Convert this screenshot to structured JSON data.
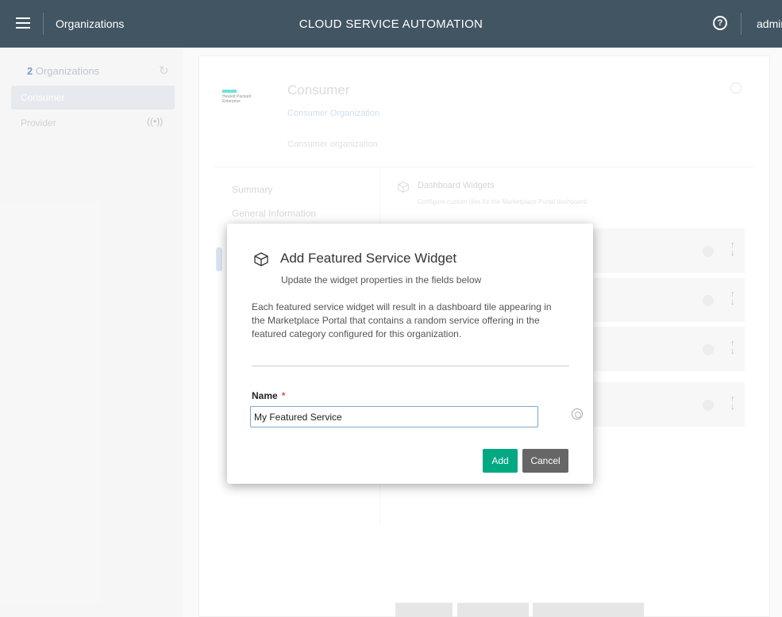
{
  "topbar": {
    "breadcrumb": "Organizations",
    "app_title": "CLOUD SERVICE AUTOMATION",
    "help_icon": "question-circle-icon",
    "user": "admin"
  },
  "sidebar": {
    "count": "2",
    "count_label": "Organizations",
    "items": [
      {
        "label": "Consumer"
      },
      {
        "label": "Provider"
      }
    ]
  },
  "org": {
    "logo_line1": "Hewlett Packard",
    "logo_line2": "Enterprise",
    "title": "Consumer",
    "link": "Consumer Organization",
    "description": "Consumer organization"
  },
  "org_nav": {
    "items": [
      "Summary",
      "General Information"
    ]
  },
  "dashboard": {
    "title": "Dashboard Widgets",
    "subtitle": "Configure custom tiles for the Marketplace Portal dashboard"
  },
  "modal": {
    "title": "Add Featured Service Widget",
    "subtitle": "Update the widget properties in the fields below",
    "description": "Each featured service widget will result in a dashboard tile appearing in the Marketplace Portal that contains a random service offering in the featured category configured for this organization.",
    "name_label": "Name",
    "required_mark": "*",
    "name_value": "My Featured Service",
    "add_label": "Add",
    "cancel_label": "Cancel"
  },
  "colors": {
    "topbar": "#425563",
    "primary_button": "#01a982",
    "secondary_button": "#666666",
    "input_focus": "#7aa7d9"
  }
}
